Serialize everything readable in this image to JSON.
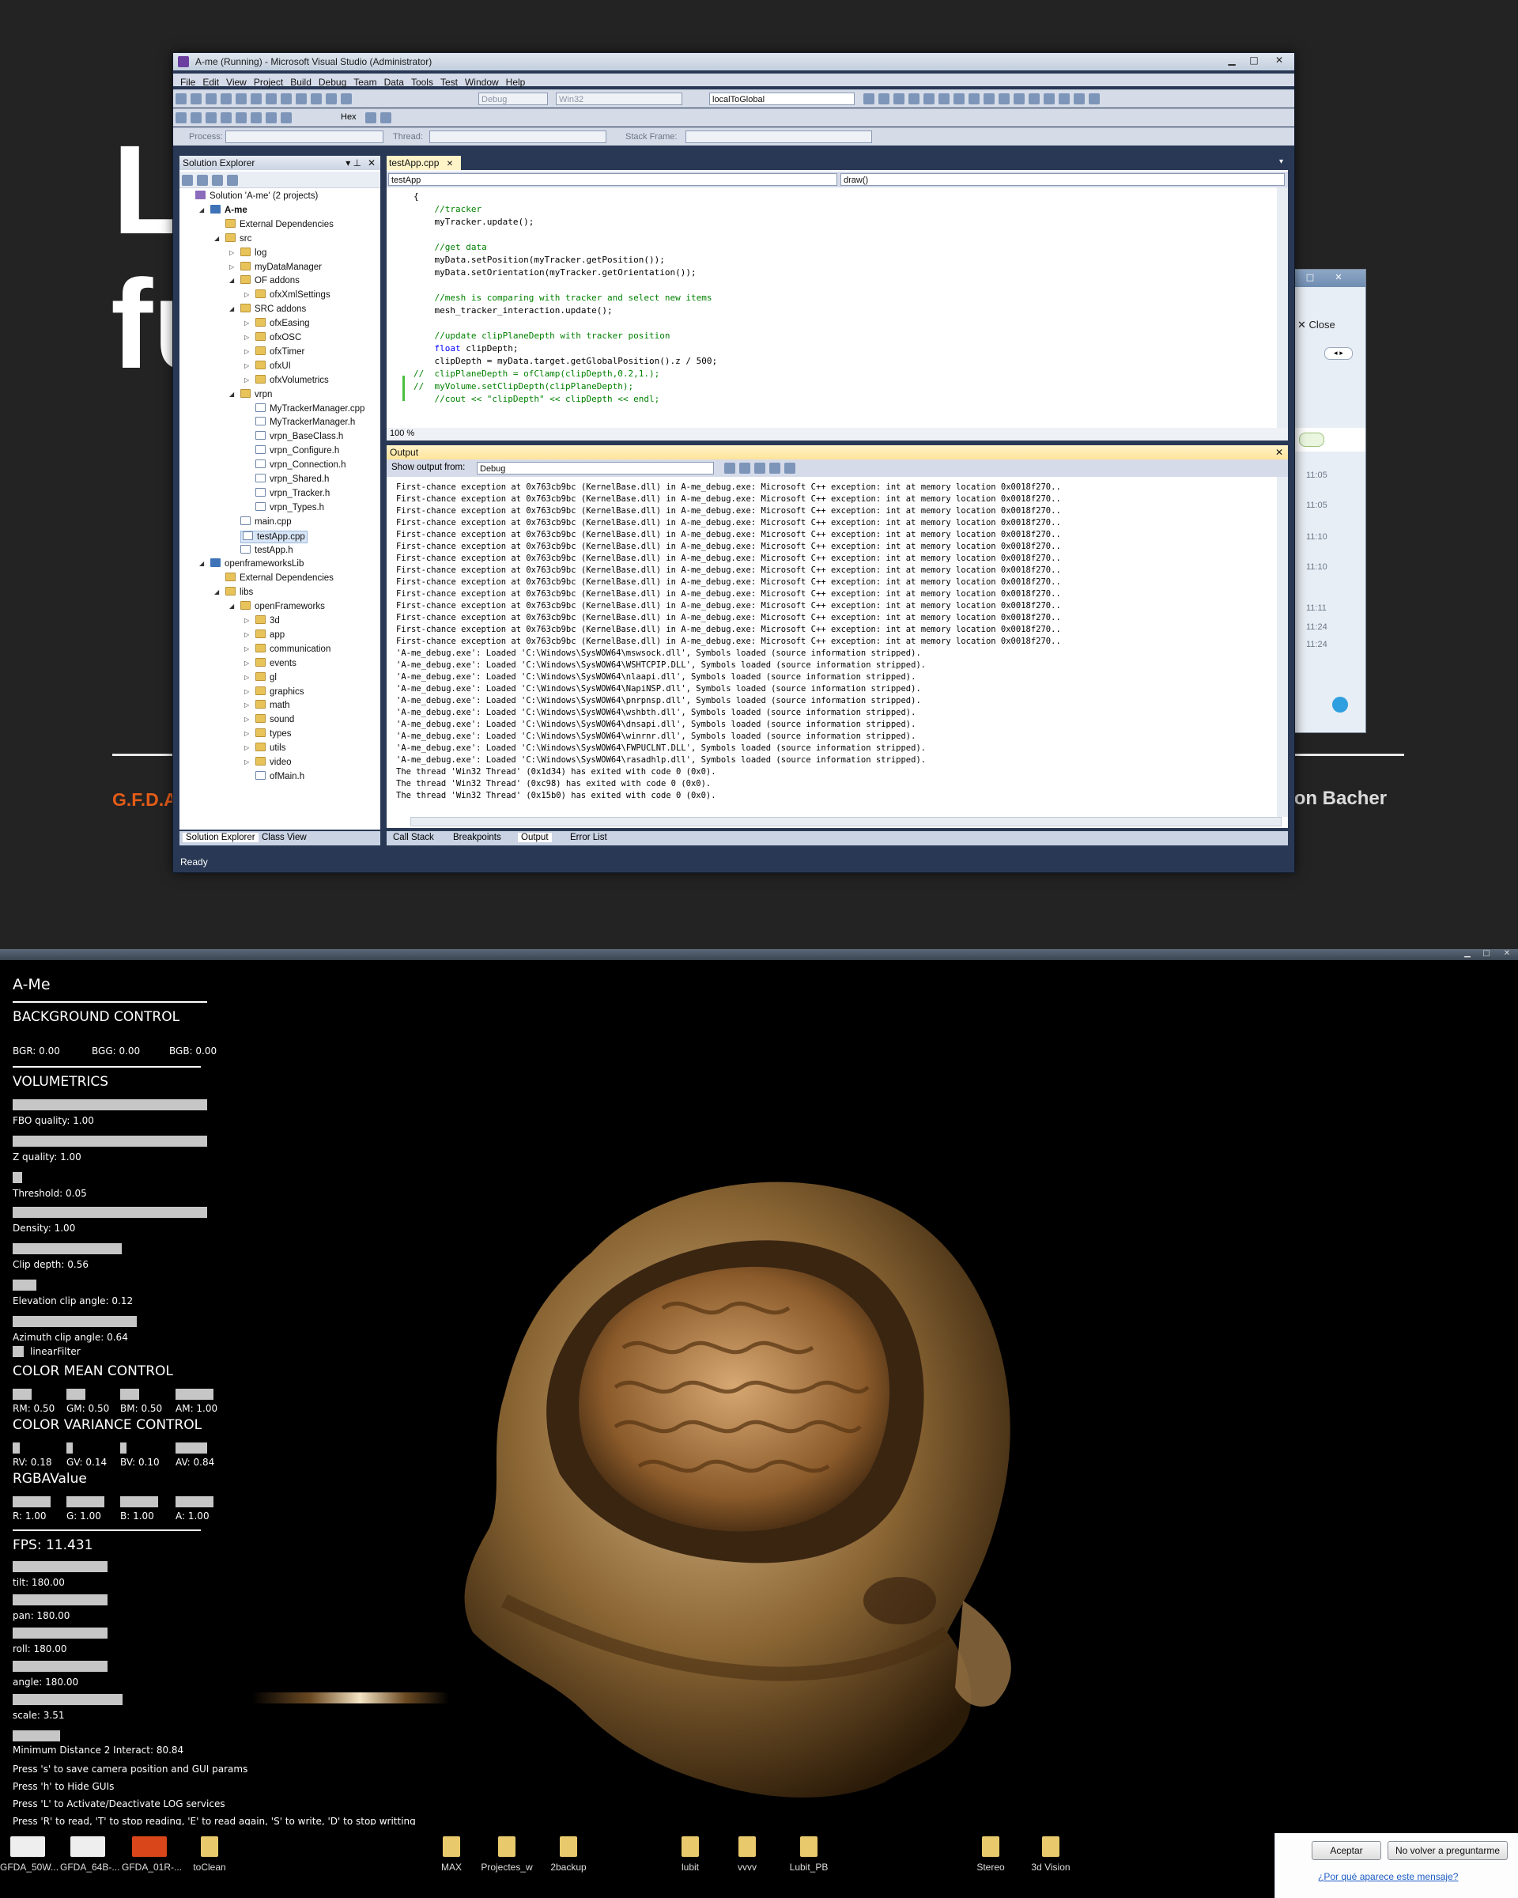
{
  "background_slide": {
    "big_letter_1": "L",
    "big_letter_2": "fu",
    "orange_text": "G.F.D.A",
    "author_text": "ason Bacher"
  },
  "side_window": {
    "close_label": "Close",
    "times": [
      "11:05",
      "11:05",
      "11:10",
      "11:10",
      "11:11",
      "11:24",
      "11:24"
    ]
  },
  "vs": {
    "title": "A-me (Running) - Microsoft Visual Studio (Administrator)",
    "menu": [
      "File",
      "Edit",
      "View",
      "Project",
      "Build",
      "Debug",
      "Team",
      "Data",
      "Tools",
      "Test",
      "Window",
      "Help"
    ],
    "toolbar": {
      "config": "Debug",
      "platform": "Win32",
      "find": "localToGlobal",
      "hex": "Hex",
      "process_label": "Process:",
      "thread_label": "Thread:",
      "stack_label": "Stack Frame:"
    },
    "solution_explorer": {
      "title": "Solution Explorer",
      "items": [
        {
          "label": "Solution 'A-me' (2 projects)",
          "depth": 0,
          "kind": "sol",
          "exp": ""
        },
        {
          "label": "A-me",
          "depth": 1,
          "kind": "proj",
          "exp": "◢"
        },
        {
          "label": "External Dependencies",
          "depth": 2,
          "kind": "folder",
          "exp": ""
        },
        {
          "label": "src",
          "depth": 2,
          "kind": "folder",
          "exp": "◢"
        },
        {
          "label": "log",
          "depth": 3,
          "kind": "folder",
          "exp": "▷"
        },
        {
          "label": "myDataManager",
          "depth": 3,
          "kind": "folder",
          "exp": "▷"
        },
        {
          "label": "OF addons",
          "depth": 3,
          "kind": "folder",
          "exp": "◢"
        },
        {
          "label": "ofxXmlSettings",
          "depth": 4,
          "kind": "folder",
          "exp": "▷"
        },
        {
          "label": "SRC addons",
          "depth": 3,
          "kind": "folder",
          "exp": "◢"
        },
        {
          "label": "ofxEasing",
          "depth": 4,
          "kind": "folder",
          "exp": "▷"
        },
        {
          "label": "ofxOSC",
          "depth": 4,
          "kind": "folder",
          "exp": "▷"
        },
        {
          "label": "ofxTimer",
          "depth": 4,
          "kind": "folder",
          "exp": "▷"
        },
        {
          "label": "ofxUI",
          "depth": 4,
          "kind": "folder",
          "exp": "▷"
        },
        {
          "label": "ofxVolumetrics",
          "depth": 4,
          "kind": "folder",
          "exp": "▷"
        },
        {
          "label": "vrpn",
          "depth": 3,
          "kind": "folder",
          "exp": "◢"
        },
        {
          "label": "MyTrackerManager.cpp",
          "depth": 4,
          "kind": "file",
          "exp": ""
        },
        {
          "label": "MyTrackerManager.h",
          "depth": 4,
          "kind": "file",
          "exp": ""
        },
        {
          "label": "vrpn_BaseClass.h",
          "depth": 4,
          "kind": "file",
          "exp": ""
        },
        {
          "label": "vrpn_Configure.h",
          "depth": 4,
          "kind": "file",
          "exp": ""
        },
        {
          "label": "vrpn_Connection.h",
          "depth": 4,
          "kind": "file",
          "exp": ""
        },
        {
          "label": "vrpn_Shared.h",
          "depth": 4,
          "kind": "file",
          "exp": ""
        },
        {
          "label": "vrpn_Tracker.h",
          "depth": 4,
          "kind": "file",
          "exp": ""
        },
        {
          "label": "vrpn_Types.h",
          "depth": 4,
          "kind": "file",
          "exp": ""
        },
        {
          "label": "main.cpp",
          "depth": 3,
          "kind": "file",
          "exp": ""
        },
        {
          "label": "testApp.cpp",
          "depth": 3,
          "kind": "file",
          "exp": "",
          "selected": true
        },
        {
          "label": "testApp.h",
          "depth": 3,
          "kind": "file",
          "exp": ""
        },
        {
          "label": "openframeworksLib",
          "depth": 1,
          "kind": "proj",
          "exp": "◢"
        },
        {
          "label": "External Dependencies",
          "depth": 2,
          "kind": "folder",
          "exp": ""
        },
        {
          "label": "libs",
          "depth": 2,
          "kind": "folder",
          "exp": "◢"
        },
        {
          "label": "openFrameworks",
          "depth": 3,
          "kind": "folder",
          "exp": "◢"
        },
        {
          "label": "3d",
          "depth": 4,
          "kind": "folder",
          "exp": "▷"
        },
        {
          "label": "app",
          "depth": 4,
          "kind": "folder",
          "exp": "▷"
        },
        {
          "label": "communication",
          "depth": 4,
          "kind": "folder",
          "exp": "▷"
        },
        {
          "label": "events",
          "depth": 4,
          "kind": "folder",
          "exp": "▷"
        },
        {
          "label": "gl",
          "depth": 4,
          "kind": "folder",
          "exp": "▷"
        },
        {
          "label": "graphics",
          "depth": 4,
          "kind": "folder",
          "exp": "▷"
        },
        {
          "label": "math",
          "depth": 4,
          "kind": "folder",
          "exp": "▷"
        },
        {
          "label": "sound",
          "depth": 4,
          "kind": "folder",
          "exp": "▷"
        },
        {
          "label": "types",
          "depth": 4,
          "kind": "folder",
          "exp": "▷"
        },
        {
          "label": "utils",
          "depth": 4,
          "kind": "folder",
          "exp": "▷"
        },
        {
          "label": "video",
          "depth": 4,
          "kind": "folder",
          "exp": "▷"
        },
        {
          "label": "ofMain.h",
          "depth": 4,
          "kind": "file",
          "exp": ""
        }
      ],
      "bottom_tabs": [
        "Solution Explorer",
        "Class View"
      ]
    },
    "editor": {
      "tab": "testApp.cpp",
      "scope": "testApp",
      "member": "draw()",
      "zoom": "100 %",
      "lines": [
        {
          "t": "{",
          "c": ""
        },
        {
          "t": "    //tracker",
          "c": "c"
        },
        {
          "t": "    myTracker.update();",
          "c": ""
        },
        {
          "t": "",
          "c": ""
        },
        {
          "t": "    //get data",
          "c": "c"
        },
        {
          "t": "    myData.setPosition(myTracker.getPosition());",
          "c": ""
        },
        {
          "t": "    myData.setOrientation(myTracker.getOrientation());",
          "c": ""
        },
        {
          "t": "",
          "c": ""
        },
        {
          "t": "    //mesh is comparing with tracker and select new items",
          "c": "c"
        },
        {
          "t": "    mesh_tracker_interaction.update();",
          "c": ""
        },
        {
          "t": "",
          "c": ""
        },
        {
          "t": "    //update clipPlaneDepth with tracker position",
          "c": "c"
        },
        {
          "t": "    float clipDepth;",
          "c": "kw"
        },
        {
          "t": "    clipDepth = myData.target.getGlobalPosition().z / 500;",
          "c": ""
        },
        {
          "t": "//  clipPlaneDepth = ofClamp(clipDepth,0.2,1.);",
          "c": "c"
        },
        {
          "t": "//  myVolume.setClipDepth(clipPlaneDepth);",
          "c": "c"
        },
        {
          "t": "    //cout << \"clipDepth\" << clipDepth << endl;",
          "c": "c"
        }
      ]
    },
    "output": {
      "title": "Output",
      "show_label": "Show output from:",
      "source": "Debug",
      "lines": [
        "First-chance exception at 0x763cb9bc (KernelBase.dll) in A-me_debug.exe: Microsoft C++ exception: int at memory location 0x0018f270..",
        "First-chance exception at 0x763cb9bc (KernelBase.dll) in A-me_debug.exe: Microsoft C++ exception: int at memory location 0x0018f270..",
        "First-chance exception at 0x763cb9bc (KernelBase.dll) in A-me_debug.exe: Microsoft C++ exception: int at memory location 0x0018f270..",
        "First-chance exception at 0x763cb9bc (KernelBase.dll) in A-me_debug.exe: Microsoft C++ exception: int at memory location 0x0018f270..",
        "First-chance exception at 0x763cb9bc (KernelBase.dll) in A-me_debug.exe: Microsoft C++ exception: int at memory location 0x0018f270..",
        "First-chance exception at 0x763cb9bc (KernelBase.dll) in A-me_debug.exe: Microsoft C++ exception: int at memory location 0x0018f270..",
        "First-chance exception at 0x763cb9bc (KernelBase.dll) in A-me_debug.exe: Microsoft C++ exception: int at memory location 0x0018f270..",
        "First-chance exception at 0x763cb9bc (KernelBase.dll) in A-me_debug.exe: Microsoft C++ exception: int at memory location 0x0018f270..",
        "First-chance exception at 0x763cb9bc (KernelBase.dll) in A-me_debug.exe: Microsoft C++ exception: int at memory location 0x0018f270..",
        "First-chance exception at 0x763cb9bc (KernelBase.dll) in A-me_debug.exe: Microsoft C++ exception: int at memory location 0x0018f270..",
        "First-chance exception at 0x763cb9bc (KernelBase.dll) in A-me_debug.exe: Microsoft C++ exception: int at memory location 0x0018f270..",
        "First-chance exception at 0x763cb9bc (KernelBase.dll) in A-me_debug.exe: Microsoft C++ exception: int at memory location 0x0018f270..",
        "First-chance exception at 0x763cb9bc (KernelBase.dll) in A-me_debug.exe: Microsoft C++ exception: int at memory location 0x0018f270..",
        "First-chance exception at 0x763cb9bc (KernelBase.dll) in A-me_debug.exe: Microsoft C++ exception: int at memory location 0x0018f270..",
        "'A-me_debug.exe': Loaded 'C:\\Windows\\SysWOW64\\mswsock.dll', Symbols loaded (source information stripped).",
        "'A-me_debug.exe': Loaded 'C:\\Windows\\SysWOW64\\WSHTCPIP.DLL', Symbols loaded (source information stripped).",
        "'A-me_debug.exe': Loaded 'C:\\Windows\\SysWOW64\\nlaapi.dll', Symbols loaded (source information stripped).",
        "'A-me_debug.exe': Loaded 'C:\\Windows\\SysWOW64\\NapiNSP.dll', Symbols loaded (source information stripped).",
        "'A-me_debug.exe': Loaded 'C:\\Windows\\SysWOW64\\pnrpnsp.dll', Symbols loaded (source information stripped).",
        "'A-me_debug.exe': Loaded 'C:\\Windows\\SysWOW64\\wshbth.dll', Symbols loaded (source information stripped).",
        "'A-me_debug.exe': Loaded 'C:\\Windows\\SysWOW64\\dnsapi.dll', Symbols loaded (source information stripped).",
        "'A-me_debug.exe': Loaded 'C:\\Windows\\SysWOW64\\winrnr.dll', Symbols loaded (source information stripped).",
        "'A-me_debug.exe': Loaded 'C:\\Windows\\SysWOW64\\FWPUCLNT.DLL', Symbols loaded (source information stripped).",
        "'A-me_debug.exe': Loaded 'C:\\Windows\\SysWOW64\\rasadhlp.dll', Symbols loaded (source information stripped).",
        "The thread 'Win32 Thread' (0x1d34) has exited with code 0 (0x0).",
        "The thread 'Win32 Thread' (0xc98) has exited with code 0 (0x0).",
        "The thread 'Win32 Thread' (0x15b0) has exited with code 0 (0x0)."
      ],
      "bottom_tabs": [
        "Call Stack",
        "Breakpoints",
        "Output",
        "Error List"
      ]
    },
    "status": "Ready"
  },
  "ame": {
    "title": "A-Me",
    "bg_header": "BACKGROUND CONTROL",
    "bg_values": [
      "BGR: 0.00",
      "BGG: 0.00",
      "BGB: 0.00"
    ],
    "vol_header": "VOLUMETRICS",
    "sliders": [
      {
        "label": "FBO quality: 1.00",
        "fraction": 1.0
      },
      {
        "label": "Z quality: 1.00",
        "fraction": 1.0
      },
      {
        "label": "Threshold: 0.05",
        "fraction": 0.05
      },
      {
        "label": "Density: 1.00",
        "fraction": 1.0
      },
      {
        "label": "Clip depth: 0.56",
        "fraction": 0.56
      },
      {
        "label": "Elevation clip angle: 0.12",
        "fraction": 0.12
      },
      {
        "label": "Azimuth clip angle: 0.64",
        "fraction": 0.64
      }
    ],
    "linear_filter": "linearFilter",
    "mean_header": "COLOR MEAN CONTROL",
    "mean_values": [
      {
        "label": "RM: 0.50",
        "fraction": 0.5
      },
      {
        "label": "GM: 0.50",
        "fraction": 0.5
      },
      {
        "label": "BM: 0.50",
        "fraction": 0.5
      },
      {
        "label": "AM: 1.00",
        "fraction": 1.0
      }
    ],
    "var_header": "COLOR VARIANCE CONTROL",
    "var_values": [
      {
        "label": "RV: 0.18",
        "fraction": 0.18
      },
      {
        "label": "GV: 0.14",
        "fraction": 0.14
      },
      {
        "label": "BV: 0.10",
        "fraction": 0.1
      },
      {
        "label": "AV: 0.84",
        "fraction": 0.84
      }
    ],
    "rgba_header": "RGBAValue",
    "rgba_values": [
      {
        "label": "R: 1.00",
        "fraction": 1.0
      },
      {
        "label": "G: 1.00",
        "fraction": 1.0
      },
      {
        "label": "B: 1.00",
        "fraction": 1.0
      },
      {
        "label": "A: 1.00",
        "fraction": 1.0
      }
    ],
    "fps": "FPS: 11.431",
    "cam_sliders": [
      {
        "label": "tilt: 180.00",
        "fraction": 0.5
      },
      {
        "label": "pan: 180.00",
        "fraction": 0.5
      },
      {
        "label": "roll: 180.00",
        "fraction": 0.5
      },
      {
        "label": "angle: 180.00",
        "fraction": 0.5
      },
      {
        "label": "scale: 3.51",
        "fraction": 0.58
      }
    ],
    "min_dist": "Minimum Distance 2 Interact: 80.84",
    "help_lines": [
      "Press 's' to save camera position and GUI params",
      "Press 'h' to Hide GUIs",
      "Press 'L' to Activate/Deactivate LOG services",
      "Press 'R' to read, 'T' to stop reading, 'E' to read again, 'S' to write, 'D' to stop writting"
    ]
  },
  "taskbar": {
    "items": [
      "GFDA_50W...",
      "GFDA_64B-...",
      "GFDA_01R-...",
      "toClean",
      "MAX",
      "Projectes_w",
      "2backup",
      "lubit",
      "vvvv",
      "Lubit_PB",
      "Stereo",
      "3d Vision"
    ]
  },
  "dialog": {
    "accept": "Aceptar",
    "never": "No volver a preguntarme",
    "why": "¿Por qué aparece este mensaje?"
  }
}
